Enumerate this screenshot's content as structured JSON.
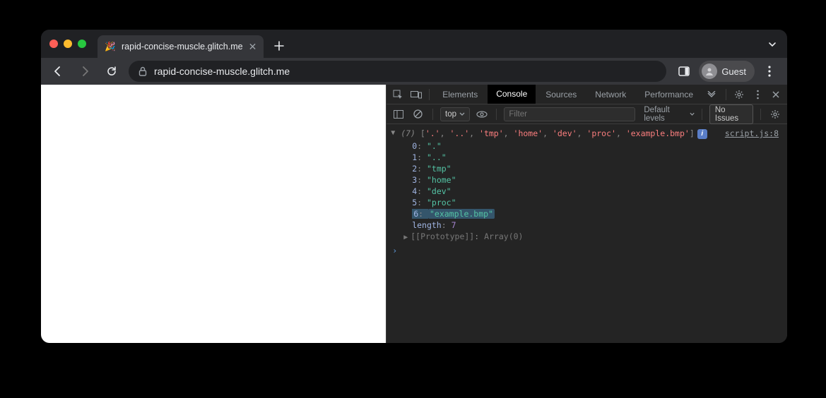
{
  "tab": {
    "favicon": "🎉",
    "title": "rapid-concise-muscle.glitch.me"
  },
  "address": {
    "url": "rapid-concise-muscle.glitch.me"
  },
  "profile": {
    "label": "Guest"
  },
  "devtools": {
    "tabs": {
      "elements": "Elements",
      "console": "Console",
      "sources": "Sources",
      "network": "Network",
      "performance": "Performance"
    },
    "context": "top",
    "filter_placeholder": "Filter",
    "levels_label": "Default levels",
    "issues_label": "No Issues"
  },
  "console": {
    "summary_count": "(7)",
    "summary_items": [
      "'.',",
      "'..',",
      "'tmp',",
      "'home',",
      "'dev',",
      "'proc',",
      "'example.bmp'"
    ],
    "source": "script.js:8",
    "array": [
      {
        "k": "0",
        "v": "\".\""
      },
      {
        "k": "1",
        "v": "\"..\""
      },
      {
        "k": "2",
        "v": "\"tmp\""
      },
      {
        "k": "3",
        "v": "\"home\""
      },
      {
        "k": "4",
        "v": "\"dev\""
      },
      {
        "k": "5",
        "v": "\"proc\""
      },
      {
        "k": "6",
        "v": "\"example.bmp\"",
        "highlight": true
      }
    ],
    "length_label": "length",
    "length_value": "7",
    "prototype_label": "[[Prototype]]",
    "prototype_value": "Array(0)"
  }
}
